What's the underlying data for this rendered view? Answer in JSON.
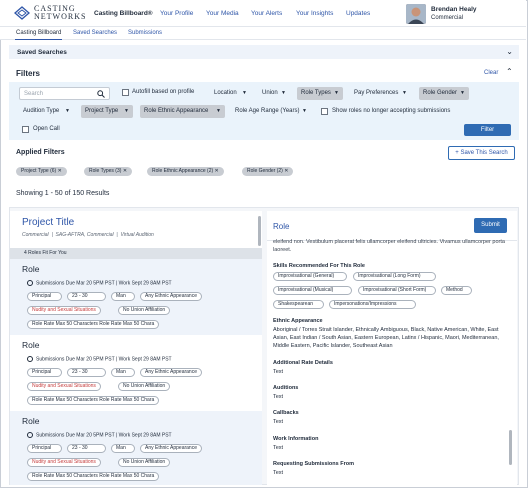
{
  "header": {
    "logo_line1": "CASTING",
    "logo_line2": "NETWORKS",
    "brand": "Casting Billboard®",
    "nav": [
      "Your Profile",
      "Your Media",
      "Your Alerts",
      "Your Insights",
      "Updates"
    ],
    "user_name": "Brendan Healy",
    "user_role": "Commercial"
  },
  "subnav": [
    "Casting Billboard",
    "Saved Searches",
    "Submissions"
  ],
  "saved": {
    "title": "Saved Searches"
  },
  "filters": {
    "title": "Filters",
    "clear": "Clear",
    "search_placeholder": "Search",
    "autofill": "Autofill based on profile",
    "location": "Location",
    "union": "Union",
    "role_types": "Role Types",
    "pay": "Pay Preferences",
    "role_gender": "Role Gender",
    "audition_type": "Audition Type",
    "project_type": "Project Type",
    "ethnic": "Role Ethnic Appearance",
    "age_range": "Role Age Range (Years)",
    "no_longer": "Show roles no longer accepting submissions",
    "open_call": "Open Call",
    "filter_btn": "Filter"
  },
  "applied": {
    "title": "Applied Filters",
    "save": "+ Save This Search",
    "chips": [
      "Project Type (6)",
      "Role Types (3)",
      "Role Ethnic Appearance (2)",
      "Role Gender (2)"
    ]
  },
  "showing": "Showing 1 - 50 of 150 Results",
  "project": {
    "title": "Project Title",
    "meta": [
      "Commercial",
      "SAG-AFTRA, Commercial",
      "Virtual Audition"
    ],
    "fit": "4 Roles Fit For You"
  },
  "roles": [
    {
      "name": "Role",
      "sub": "Submissions Due Mar 20 5PM PST  |  Work Sept 29 8AM PST",
      "tags": [
        "Principal",
        "23 - 30",
        "Man",
        "Any Ethnic Appearance"
      ],
      "nudity": "Nudity and Sexual Situations",
      "union": "No Union Affiliation",
      "rate": "Role Rate Max 50 Characters Role Rate Max 50 Chara"
    },
    {
      "name": "Role",
      "sub": "Submissions Due Mar 20 5PM PST  |  Work Sept 29 8AM PST",
      "tags": [
        "Principal",
        "23 - 30",
        "Man",
        "Any Ethnic Appearance"
      ],
      "nudity": "Nudity and Sexual Situations",
      "union": "No Union Affiliation",
      "rate": "Role Rate Max 50 Characters Role Rate Max 50 Chara"
    },
    {
      "name": "Role",
      "sub": "Submissions Due Mar 20 5PM PST  |  Work Sept 29 8AM PST",
      "tags": [
        "Principal",
        "23 - 30",
        "Man",
        "Any Ethnic Appearance"
      ],
      "nudity": "Nudity and Sexual Situations",
      "union": "No Union Affiliation",
      "rate": "Role Rate Max 50 Characters Role Rate Max 50 Chara"
    }
  ],
  "detail": {
    "title": "Role",
    "submit": "Submit",
    "intro": "eleifend non. Vestibulum placerat felis ullamcorper eleifend ultricies. Vivamus ullamcorper porta laoreet.",
    "skills_h": "Skills Recommended For This Role",
    "skills": [
      "Improvisational (General)",
      "Improvisational (Long Form)",
      "Improvisational (Musical)",
      "Improvisational (Short Form)",
      "Method",
      "Shakespearean",
      "Impersonations/Impressions"
    ],
    "ethnic_h": "Ethnic Appearance",
    "ethnic_t": "Aboriginal / Torres Strait Islander, Ethnically Ambiguous, Black, Native American, White, East Asian, East Indian / South Asian, Eastern European, Latinx / Hispanic, Maori, Mediterranean, Middle Eastern, Pacific Islander, Southeast Asian",
    "sections": [
      {
        "h": "Additional Rate Details",
        "t": "Text"
      },
      {
        "h": "Auditions",
        "t": "Text"
      },
      {
        "h": "Callbacks",
        "t": "Text"
      },
      {
        "h": "Work Information",
        "t": "Text"
      },
      {
        "h": "Requesting Submissions From",
        "t": "Text"
      }
    ]
  }
}
